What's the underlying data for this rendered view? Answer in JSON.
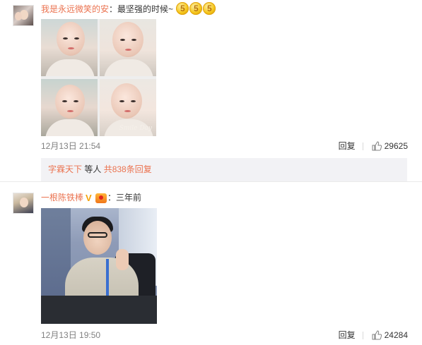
{
  "comments": [
    {
      "username": "我是永远微笑的安",
      "separator": "：",
      "text": "最坚强的时候~",
      "emoji_glyph": "5",
      "emoji_icon": "sad-cry-emoji-icon",
      "timestamp": "12月13日 21:54",
      "reply_label": "回复",
      "likes": "29625",
      "photo_watermark": "Smile Day",
      "sub_replies": {
        "user": "字霖天下",
        "middle": " 等人 ",
        "count_text": "共838条回复"
      }
    },
    {
      "username": "一根陈铁棒",
      "badge_v": "V",
      "separator": "：",
      "text": "三年前",
      "timestamp": "12月13日 19:50",
      "reply_label": "回复",
      "likes": "24284"
    }
  ],
  "colors": {
    "username": "#eb7350",
    "text": "#333333",
    "meta": "#808080",
    "subreply_bg": "#f2f2f5"
  }
}
